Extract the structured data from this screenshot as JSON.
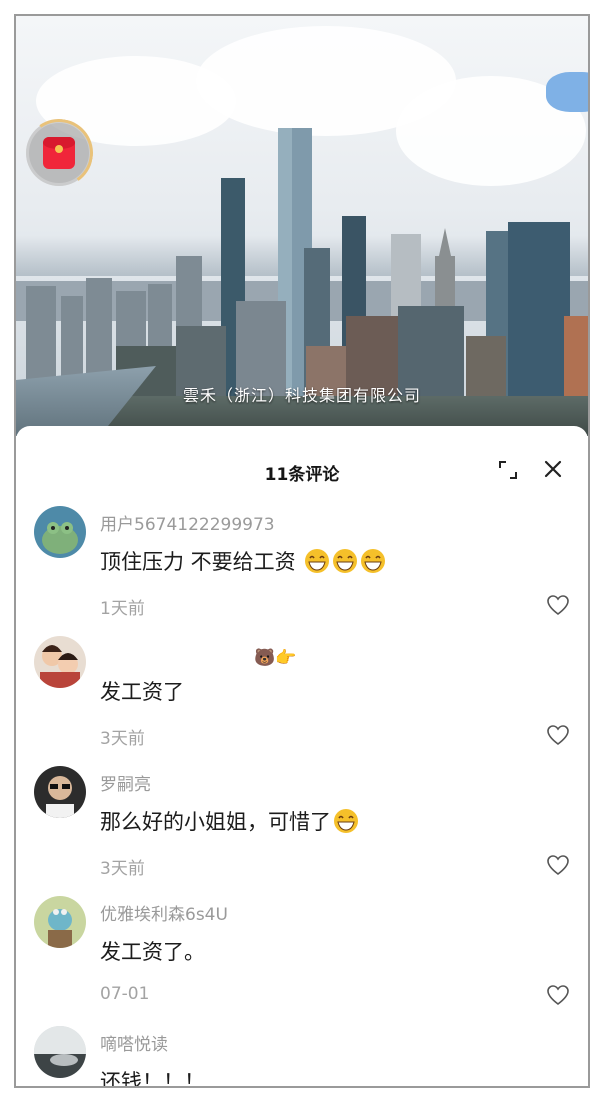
{
  "video": {
    "watermark": "雲禾（浙江）科技集团有限公司",
    "red_packet_icon": "red-envelope-icon"
  },
  "comments_panel": {
    "title": "11条评论",
    "expand_icon": "expand-icon",
    "close_icon": "close-icon",
    "comments": [
      {
        "username": "用户5674122299973",
        "text": "顶住压力 不要给工资",
        "emoji_count": 3,
        "time": "1天前"
      },
      {
        "username": "",
        "badge": "🐻👉",
        "text": "发工资了",
        "emoji_count": 0,
        "time": "3天前"
      },
      {
        "username": "罗嗣亮",
        "text": "那么好的小姐姐，可惜了",
        "emoji_count": 1,
        "time": "3天前"
      },
      {
        "username": "优雅埃利森6s4U",
        "text": "发工资了。",
        "emoji_count": 0,
        "time": "07-01"
      },
      {
        "username": "嘀嗒悦读",
        "text": "还钱！！！",
        "emoji_count": 0,
        "time": ""
      }
    ]
  },
  "colors": {
    "username": "#9a9a9a",
    "comment_text": "#1c1c1c",
    "timestamp": "#a3a3a3",
    "red_packet": "#f0263a"
  }
}
